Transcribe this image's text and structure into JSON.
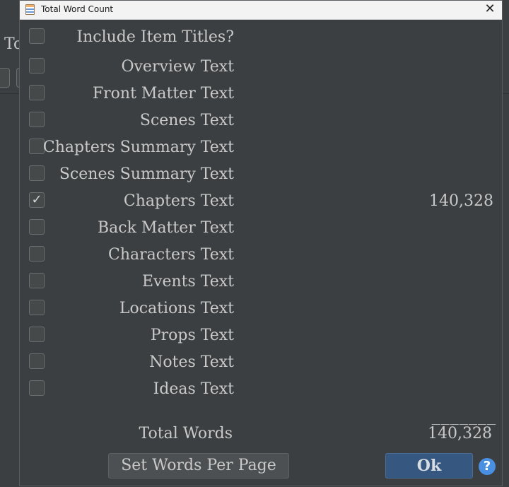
{
  "background_app": {
    "title_fragment": "To"
  },
  "dialog": {
    "title": "Total Word Count",
    "close_symbol": "✕",
    "options": [
      {
        "label": "Include Item Titles?",
        "checked": false,
        "value": ""
      },
      {
        "label": "Overview Text",
        "checked": false,
        "value": ""
      },
      {
        "label": "Front Matter Text",
        "checked": false,
        "value": ""
      },
      {
        "label": "Scenes Text",
        "checked": false,
        "value": ""
      },
      {
        "label": "Chapters Summary Text",
        "checked": false,
        "value": ""
      },
      {
        "label": "Scenes Summary Text",
        "checked": false,
        "value": ""
      },
      {
        "label": "Chapters Text",
        "checked": true,
        "value": "140,328"
      },
      {
        "label": "Back Matter Text",
        "checked": false,
        "value": ""
      },
      {
        "label": "Characters Text",
        "checked": false,
        "value": ""
      },
      {
        "label": "Events Text",
        "checked": false,
        "value": ""
      },
      {
        "label": "Locations Text",
        "checked": false,
        "value": ""
      },
      {
        "label": "Props Text",
        "checked": false,
        "value": ""
      },
      {
        "label": "Notes Text",
        "checked": false,
        "value": ""
      },
      {
        "label": "Ideas Text",
        "checked": false,
        "value": ""
      }
    ],
    "separator": "_______",
    "total_label": "Total Words",
    "total_value": "140,328",
    "set_words_per_page_label": "Set Words Per Page",
    "ok_label": "Ok",
    "help_symbol": "?",
    "check_glyph": "✓"
  },
  "colors": {
    "accent": "#365880",
    "help": "#4a90e2",
    "background": "#3c3f41"
  }
}
